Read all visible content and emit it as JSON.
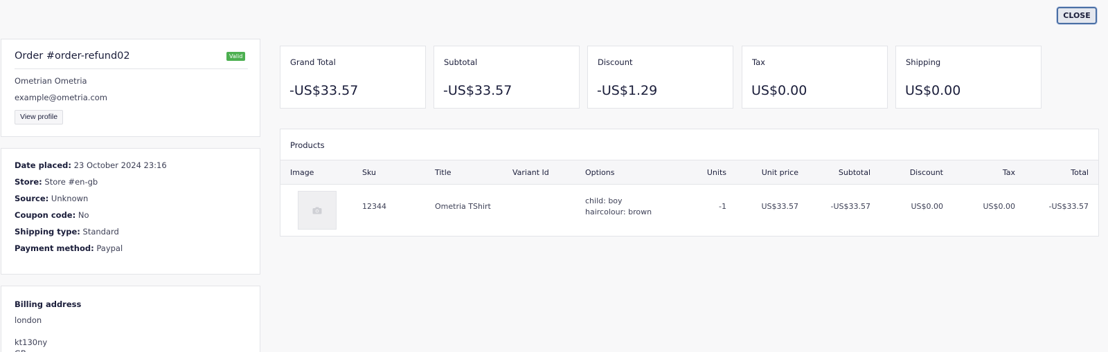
{
  "close_label": "CLOSE",
  "order": {
    "title": "Order #order-refund02",
    "status": "Valid",
    "customer_name": "Ometrian Ometria",
    "customer_email": "example@ometria.com",
    "view_profile_label": "View profile"
  },
  "details": [
    {
      "label": "Date placed:",
      "value": "23 October 2024 23:16"
    },
    {
      "label": "Store:",
      "value": "Store #en-gb"
    },
    {
      "label": "Source:",
      "value": "Unknown"
    },
    {
      "label": "Coupon code:",
      "value": "No"
    },
    {
      "label": "Shipping type:",
      "value": "Standard"
    },
    {
      "label": "Payment method:",
      "value": "Paypal"
    }
  ],
  "billing": {
    "title": "Billing address",
    "lines": [
      "london",
      "kt130ny",
      "GB"
    ]
  },
  "totals": [
    {
      "label": "Grand Total",
      "value": "-US$33.57"
    },
    {
      "label": "Subtotal",
      "value": "-US$33.57"
    },
    {
      "label": "Discount",
      "value": "-US$1.29"
    },
    {
      "label": "Tax",
      "value": "US$0.00"
    },
    {
      "label": "Shipping",
      "value": "US$0.00"
    }
  ],
  "products": {
    "title": "Products",
    "columns": [
      "Image",
      "Sku",
      "Title",
      "Variant Id",
      "Options",
      "Units",
      "Unit price",
      "Subtotal",
      "Discount",
      "Tax",
      "Total"
    ],
    "rows": [
      {
        "image_icon": "camera-icon",
        "sku": "12344",
        "title": "Ometria TShirt",
        "variant_id": "",
        "options": [
          "child: boy",
          "haircolour: brown"
        ],
        "units": "-1",
        "unit_price": "US$33.57",
        "subtotal": "-US$33.57",
        "discount": "US$0.00",
        "tax": "US$0.00",
        "total": "-US$33.57"
      }
    ]
  },
  "colors": {
    "background": "#f8f8f9",
    "valid_badge": "#4caf50",
    "text": "#1a1d3a"
  }
}
